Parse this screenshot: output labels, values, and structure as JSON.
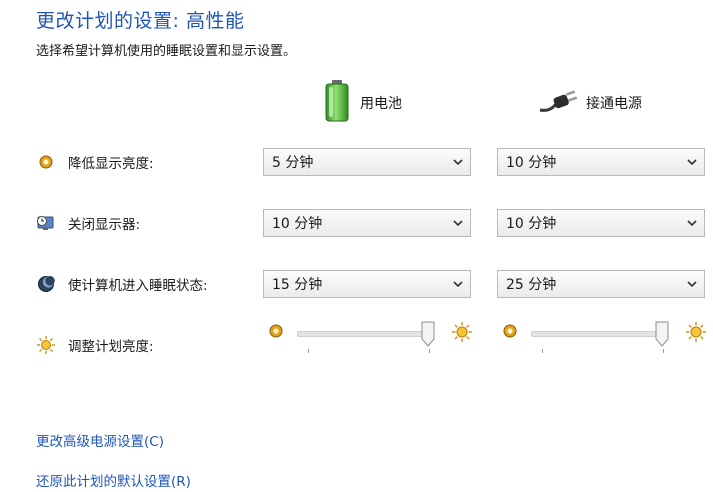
{
  "header": {
    "title": "更改计划的设置: 高性能",
    "subtitle": "选择希望计算机使用的睡眠设置和显示设置。"
  },
  "columns": {
    "battery": {
      "label": "用电池",
      "icon": "battery-icon"
    },
    "plugged": {
      "label": "接通电源",
      "icon": "power-plug-icon"
    }
  },
  "settings": {
    "dim_display": {
      "label": "降低显示亮度:",
      "icon": "dim-brightness-icon",
      "battery": "5 分钟",
      "plugged": "10 分钟"
    },
    "turn_off_display": {
      "label": "关闭显示器:",
      "icon": "monitor-clock-icon",
      "battery": "10 分钟",
      "plugged": "10 分钟"
    },
    "sleep": {
      "label": "使计算机进入睡眠状态:",
      "icon": "sleep-moon-icon",
      "battery": "15 分钟",
      "plugged": "25 分钟"
    },
    "brightness": {
      "label": "调整计划亮度:",
      "icon": "sun-icon",
      "battery_level": 1.0,
      "plugged_level": 1.0
    }
  },
  "links": {
    "advanced": "更改高级电源设置(C)",
    "restore": "还原此计划的默认设置(R)"
  },
  "colors": {
    "accent": "#1f55b8",
    "battery_green": "#49b33a",
    "sun_orange": "#e8a316"
  }
}
